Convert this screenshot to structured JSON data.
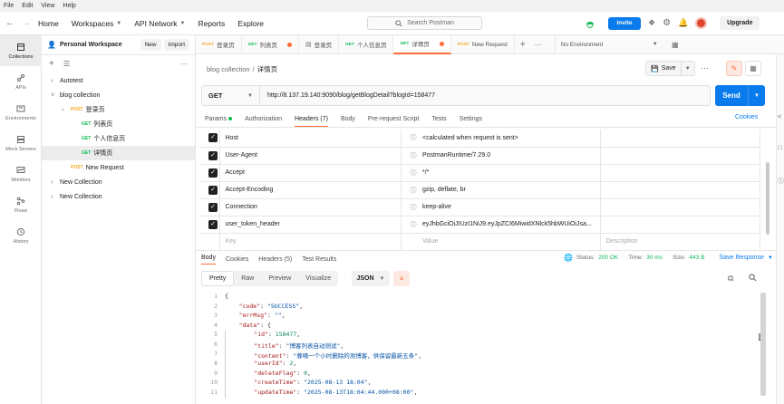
{
  "menu": [
    "File",
    "Edit",
    "View",
    "Help"
  ],
  "header": {
    "home": "Home",
    "workspaces": "Workspaces",
    "api_network": "API Network",
    "reports": "Reports",
    "explore": "Explore",
    "search_placeholder": "Search Postman",
    "invite": "Invite",
    "upgrade": "Upgrade"
  },
  "rail": [
    "Collections",
    "APIs",
    "Environments",
    "Mock Servers",
    "Monitors",
    "Flows",
    "History"
  ],
  "sidebar": {
    "workspace": "Personal Workspace",
    "new": "New",
    "import": "Import",
    "tree": [
      {
        "label": "Autotest",
        "method": "",
        "depth": 0,
        "type": "collection"
      },
      {
        "label": "blog collection",
        "method": "",
        "depth": 0,
        "type": "collection-open"
      },
      {
        "label": "登录页",
        "method": "POST",
        "depth": 1,
        "type": "folder"
      },
      {
        "label": "列表页",
        "method": "GET",
        "depth": 2,
        "type": "request"
      },
      {
        "label": "个人信息页",
        "method": "GET",
        "depth": 2,
        "type": "request"
      },
      {
        "label": "详情页",
        "method": "GET",
        "depth": 2,
        "type": "request-active"
      },
      {
        "label": "New Request",
        "method": "POST",
        "depth": 1,
        "type": "request"
      },
      {
        "label": "New Collection",
        "method": "",
        "depth": 0,
        "type": "collection"
      },
      {
        "label": "New Collection",
        "method": "",
        "depth": 0,
        "type": "collection"
      }
    ]
  },
  "tabs": [
    {
      "method": "POST",
      "label": "登录页"
    },
    {
      "method": "GET",
      "label": "列表页"
    },
    {
      "method": "",
      "label": "登录页"
    },
    {
      "method": "GET",
      "label": "个人信息页"
    },
    {
      "method": "GET",
      "label": "详情页"
    },
    {
      "method": "POST",
      "label": "New Request"
    }
  ],
  "environment": "No Environment",
  "breadcrumb": {
    "parent": "blog collection",
    "current": "详情页"
  },
  "save": "Save",
  "request": {
    "method": "GET",
    "url": "http://8.137.19.140:9090/blog/getBlogDetail?blogId=158477",
    "send": "Send"
  },
  "req_tabs": [
    "Params",
    "Authorization",
    "Headers (7)",
    "Body",
    "Pre-request Script",
    "Tests",
    "Settings"
  ],
  "cookies": "Cookies",
  "headers": [
    {
      "key": "Host",
      "value": "<calculated when request is sent>"
    },
    {
      "key": "User-Agent",
      "value": "PostmanRuntime/7.29.0"
    },
    {
      "key": "Accept",
      "value": "*/*"
    },
    {
      "key": "Accept-Encoding",
      "value": "gzip, deflate, br"
    },
    {
      "key": "Connection",
      "value": "keep-alive"
    },
    {
      "key": "user_token_header",
      "value": "eyJhbGciOiJIUzI1NiJ9.eyJpZCI6MiwidXNlck5hbWUiOiJsa..."
    }
  ],
  "headers_placeholder": {
    "key": "Key",
    "value": "Value",
    "description": "Description"
  },
  "resp_tabs": [
    "Body",
    "Cookies",
    "Headers (5)",
    "Test Results"
  ],
  "status": {
    "status_label": "Status:",
    "status": "200 OK",
    "time_label": "Time:",
    "time": "30 ms",
    "size_label": "Size:",
    "size": "443 B",
    "save_response": "Save Response"
  },
  "view_tabs": [
    "Pretty",
    "Raw",
    "Preview",
    "Visualize"
  ],
  "format": "JSON",
  "code": [
    [
      [
        "p",
        "{"
      ]
    ],
    [
      [
        "p",
        "    "
      ],
      [
        "k",
        "\"code\""
      ],
      [
        "p",
        ": "
      ],
      [
        "s",
        "\"SUCCESS\""
      ],
      [
        "p",
        ","
      ]
    ],
    [
      [
        "p",
        "    "
      ],
      [
        "k",
        "\"errMsg\""
      ],
      [
        "p",
        ": "
      ],
      [
        "s",
        "\"\""
      ],
      [
        "p",
        ","
      ]
    ],
    [
      [
        "p",
        "    "
      ],
      [
        "k",
        "\"data\""
      ],
      [
        "p",
        ": {"
      ]
    ],
    [
      [
        "p",
        "        "
      ],
      [
        "k",
        "\"id\""
      ],
      [
        "p",
        ": "
      ],
      [
        "n",
        "158477"
      ],
      [
        "p",
        ","
      ]
    ],
    [
      [
        "p",
        "        "
      ],
      [
        "k",
        "\"title\""
      ],
      [
        "p",
        ": "
      ],
      [
        "s",
        "\"博客列表自动测试\""
      ],
      [
        "p",
        ","
      ]
    ],
    [
      [
        "p",
        "        "
      ],
      [
        "k",
        "\"content\""
      ],
      [
        "p",
        ": "
      ],
      [
        "s",
        "\"尊嘀一个小时删除的测博客，供保留最新五条\""
      ],
      [
        "p",
        ","
      ]
    ],
    [
      [
        "p",
        "        "
      ],
      [
        "k",
        "\"userId\""
      ],
      [
        "p",
        ": "
      ],
      [
        "n",
        "2"
      ],
      [
        "p",
        ","
      ]
    ],
    [
      [
        "p",
        "        "
      ],
      [
        "k",
        "\"deleteFlag\""
      ],
      [
        "p",
        ": "
      ],
      [
        "n",
        "0"
      ],
      [
        "p",
        ","
      ]
    ],
    [
      [
        "p",
        "        "
      ],
      [
        "k",
        "\"createTime\""
      ],
      [
        "p",
        ": "
      ],
      [
        "s",
        "\"2025-08-13 18:04\""
      ],
      [
        "p",
        ","
      ]
    ],
    [
      [
        "p",
        "        "
      ],
      [
        "k",
        "\"updateTime\""
      ],
      [
        "p",
        ": "
      ],
      [
        "s",
        "\"2025-08-13T18:04:44.000+08:00\""
      ],
      [
        "p",
        ","
      ]
    ]
  ]
}
